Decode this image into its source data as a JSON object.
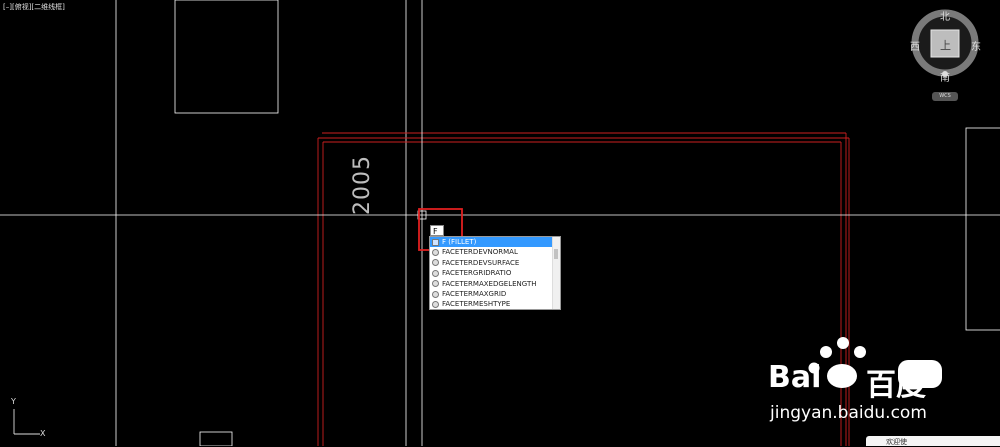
{
  "viewport": {
    "label": "[–][俯视][二维线框]"
  },
  "drawing": {
    "dimension_text": "2005"
  },
  "command": {
    "typed": "F"
  },
  "autocomplete": {
    "items": [
      "F (FILLET)",
      "FACETERDEVNORMAL",
      "FACETERDEVSURFACE",
      "FACETERGRIDRATIO",
      "FACETERMAXEDGELENGTH",
      "FACETERMAXGRID",
      "FACETERMESHTYPE"
    ],
    "selected_index": 0
  },
  "viewcube": {
    "north": "北",
    "south": "南",
    "east": "东",
    "west": "西",
    "face": "上",
    "wcs": "WCS"
  },
  "ucs": {
    "x": "X",
    "y": "Y"
  },
  "watermark": {
    "brand": "Bai",
    "brand2": "百度",
    "site": "jingyan.baidu.com"
  },
  "taskbar": {
    "label": "欢迎使"
  },
  "colors": {
    "background": "#000000",
    "line": "#ffffff",
    "red_line": "#cc1f1f",
    "highlight_box": "#e02020",
    "selection": "#3399ff"
  }
}
